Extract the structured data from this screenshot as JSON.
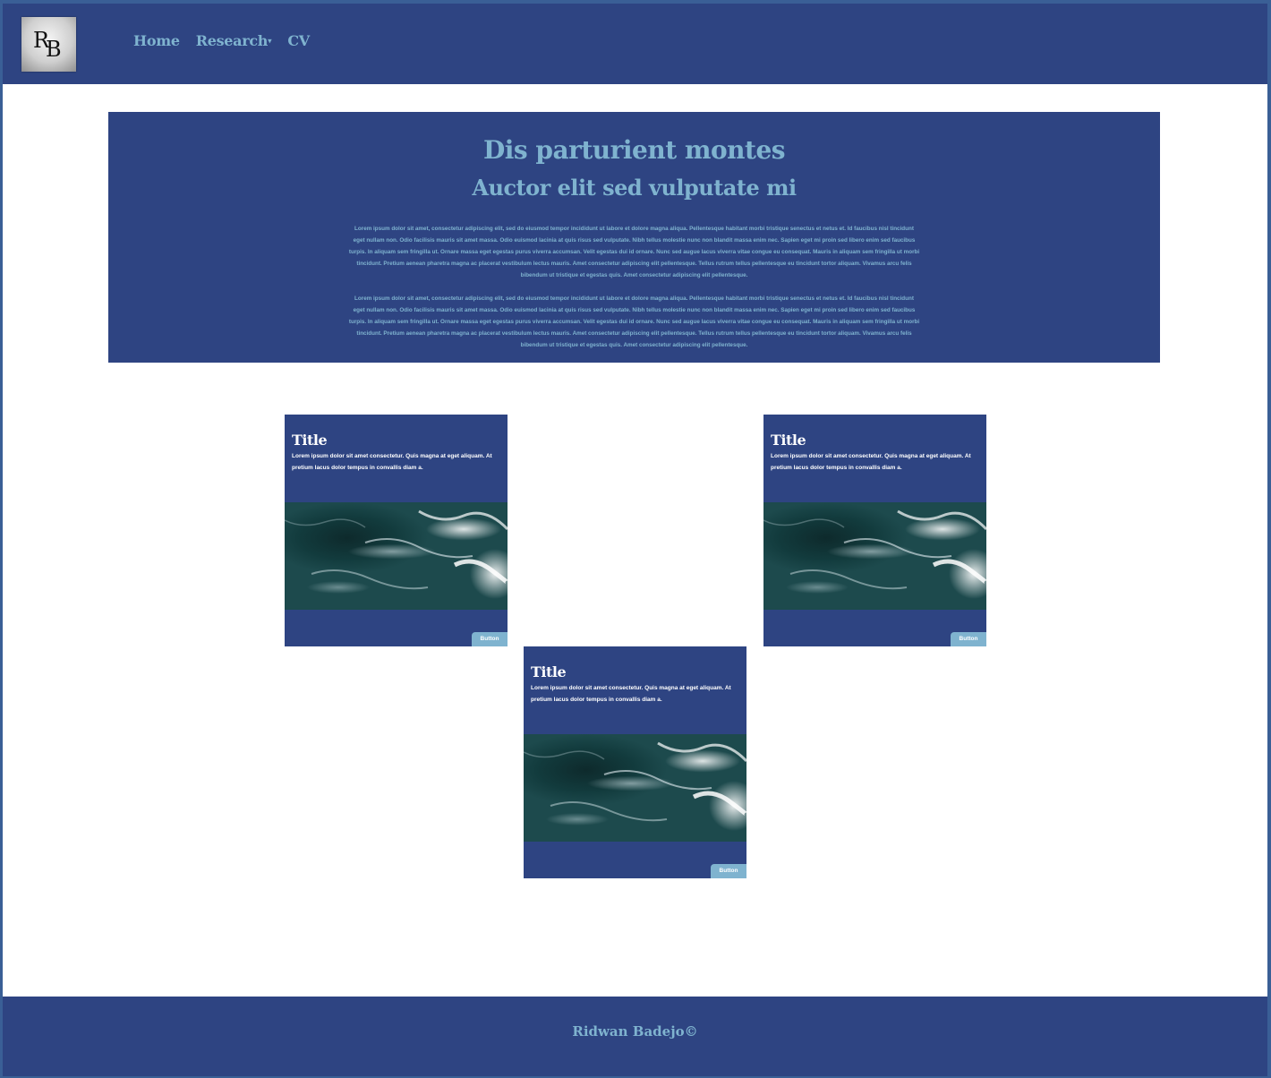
{
  "nav": {
    "logo_letters": [
      "R",
      "B"
    ],
    "items": [
      {
        "label": "Home"
      },
      {
        "label": "Research",
        "has_dropdown": true
      },
      {
        "label": "CV"
      }
    ]
  },
  "hero": {
    "title": "Dis parturient montes",
    "subtitle": "Auctor elit sed vulputate mi",
    "paragraphs": [
      "Lorem ipsum dolor sit amet, consectetur adipiscing elit, sed do eiusmod tempor incididunt ut labore et dolore magna aliqua. Pellentesque habitant morbi tristique senectus et netus et. Id faucibus nisl tincidunt eget nullam non. Odio facilisis mauris sit amet massa. Odio euismod lacinia at quis risus sed vulputate. Nibh tellus molestie nunc non blandit massa enim nec. Sapien eget mi proin sed libero enim sed faucibus turpis. In aliquam sem fringilla ut. Ornare massa eget egestas purus viverra accumsan. Velit egestas dui id ornare. Nunc sed augue lacus viverra vitae congue eu consequat. Mauris in aliquam sem fringilla ut morbi tincidunt. Pretium aenean pharetra magna ac placerat vestibulum lectus mauris. Amet consectetur adipiscing elit pellentesque. Tellus rutrum tellus pellentesque eu tincidunt tortor aliquam. Vivamus arcu felis bibendum ut tristique et egestas quis. Amet consectetur adipiscing elit pellentesque.",
      "Lorem ipsum dolor sit amet, consectetur adipiscing elit, sed do eiusmod tempor incididunt ut labore et dolore magna aliqua. Pellentesque habitant morbi tristique senectus et netus et. Id faucibus nisl tincidunt eget nullam non. Odio facilisis mauris sit amet massa. Odio euismod lacinia at quis risus sed vulputate. Nibh tellus molestie nunc non blandit massa enim nec. Sapien eget mi proin sed libero enim sed faucibus turpis. In aliquam sem fringilla ut. Ornare massa eget egestas purus viverra accumsan. Velit egestas dui id ornare. Nunc sed augue lacus viverra vitae congue eu consequat. Mauris in aliquam sem fringilla ut morbi tincidunt. Pretium aenean pharetra magna ac placerat vestibulum lectus mauris. Amet consectetur adipiscing elit pellentesque. Tellus rutrum tellus pellentesque eu tincidunt tortor aliquam. Vivamus arcu felis bibendum ut tristique et egestas quis. Amet consectetur adipiscing elit pellentesque."
    ]
  },
  "cards": [
    {
      "title": "Title",
      "text": "Lorem ipsum dolor sit amet consectetur. Quis magna at eget aliquam. At pretium lacus dolor tempus in convallis diam a.",
      "button": "Button"
    },
    {
      "title": "Title",
      "text": "Lorem ipsum dolor sit amet consectetur. Quis magna at eget aliquam. At pretium lacus dolor tempus in convallis diam a.",
      "button": "Button"
    },
    {
      "title": "Title",
      "text": "Lorem ipsum dolor sit amet consectetur. Quis magna at eget aliquam. At pretium lacus dolor tempus in convallis diam a.",
      "button": "Button"
    }
  ],
  "footer": {
    "text": "Ridwan Badejo©"
  },
  "colors": {
    "primary": "#2e4482",
    "accent": "#7fb3cf",
    "background": "#ffffff"
  }
}
